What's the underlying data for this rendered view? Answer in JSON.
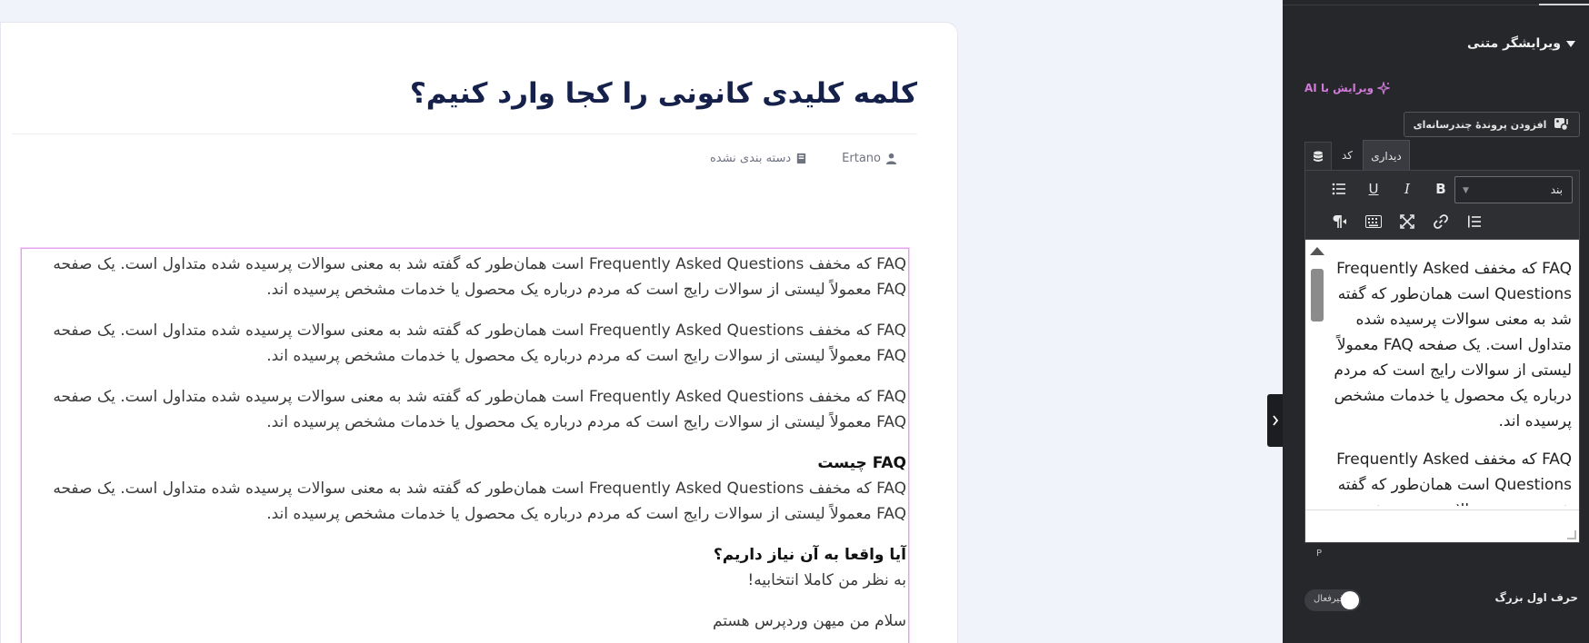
{
  "post": {
    "title": "کلمه کلیدی کانونی را کجا وارد کنیم؟",
    "author": "Ertano",
    "category": "دسته بندی نشده"
  },
  "content": {
    "p1": "FAQ که مخفف Frequently Asked Questions است همان‌طور که گفته شد به معنی سوالات پرسیده شده متداول است. یک صفحه FAQ معمولاً لیستی از سوالات رایج است که مردم درباره یک محصول یا خدمات مشخص پرسیده اند.",
    "p2": "FAQ که مخفف Frequently Asked Questions است همان‌طور که گفته شد به معنی سوالات پرسیده شده متداول است. یک صفحه FAQ معمولاً لیستی از سوالات رایج است که مردم درباره یک محصول یا خدمات مشخص پرسیده اند.",
    "p3": "FAQ که مخفف Frequently Asked Questions است همان‌طور که گفته شد به معنی سوالات پرسیده شده متداول است. یک صفحه FAQ معمولاً لیستی از سوالات رایج است که مردم درباره یک محصول یا خدمات مشخص پرسیده اند.",
    "h1": "FAQ چیست",
    "p4": "FAQ که مخفف Frequently Asked Questions است همان‌طور که گفته شد به معنی سوالات پرسیده شده متداول است. یک صفحه FAQ معمولاً لیستی از سوالات رایج است که مردم درباره یک محصول یا خدمات مشخص پرسیده اند.",
    "h2": "آیا واقعا به آن نیاز داریم؟",
    "p5": "به نظر من کاملا انتخابیه!",
    "p6": "سلام من میهن وردپرس هستم"
  },
  "panel": {
    "section_title": "ویرایشگر متنی",
    "ai_edit": "ویرایش با AI",
    "add_media": "افزودن پروندهٔ چندرسانه‌ای",
    "tab_visual": "دیداری",
    "tab_code": "کد",
    "format_value": "بند",
    "toolbar_bold": "B",
    "toolbar_italic": "I",
    "toolbar_underline": "U",
    "editor_path": "P",
    "dropcap_label": "حرف اول بزرگ",
    "dropcap_state": "غیرفعال",
    "editor_p1": "FAQ که مخفف Frequently Asked Questions است همان‌طور که گفته شد به معنی سوالات پرسیده شده متداول است. یک صفحه FAQ معمولاً لیستی از سوالات رایج است که مردم درباره یک محصول یا خدمات مشخص پرسیده اند.",
    "editor_p2": "FAQ که مخفف Frequently Asked Questions است همان‌طور که گفته شد به معنی سوالات پرسیده شده متداول است."
  },
  "colors": {
    "title": "#15214a",
    "panel_bg": "#26272b",
    "ai_accent": "#d27ad9",
    "selection_border": "#e6a0ef"
  },
  "icons": [
    "user-icon",
    "book-icon",
    "sparkle-icon",
    "media-icon",
    "database-icon",
    "chevron-down-icon",
    "chevron-right-icon",
    "bullet-list-icon",
    "numbered-list-icon",
    "link-icon",
    "fullscreen-icon",
    "keyboard-icon",
    "paragraph-rtl-icon"
  ]
}
